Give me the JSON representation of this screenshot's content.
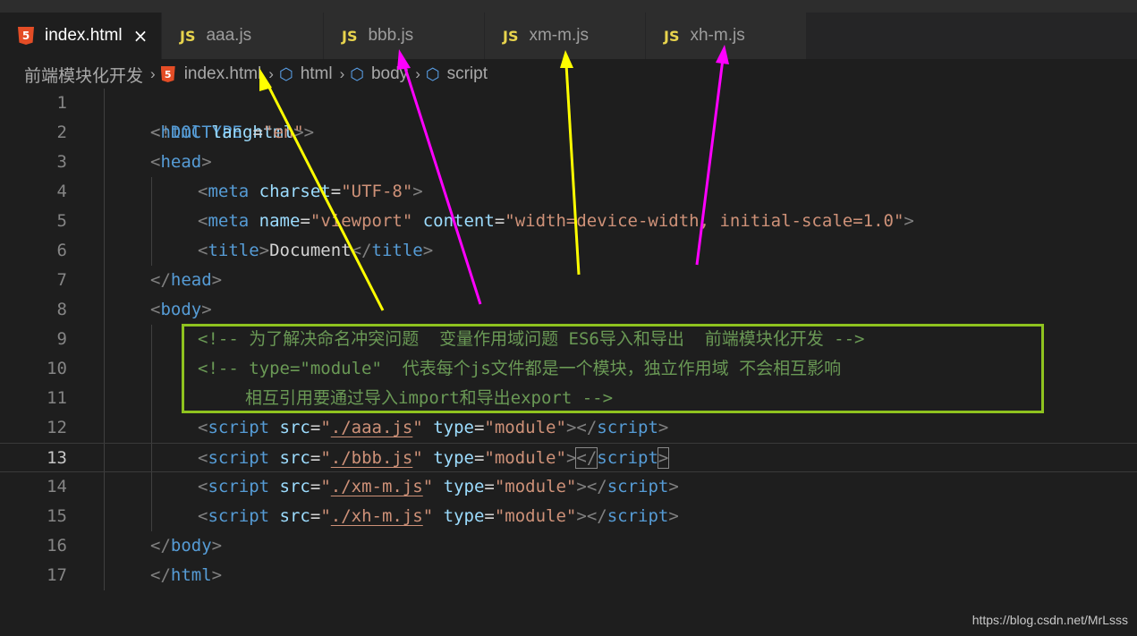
{
  "tabs": [
    {
      "label": "index.html",
      "type": "html",
      "active": true,
      "close": "×"
    },
    {
      "label": "aaa.js",
      "type": "js"
    },
    {
      "label": "bbb.js",
      "type": "js"
    },
    {
      "label": "xm-m.js",
      "type": "js"
    },
    {
      "label": "xh-m.js",
      "type": "js"
    }
  ],
  "tab_icons": {
    "js": "JS",
    "html": "5"
  },
  "breadcrumb": {
    "folder": "前端模块化开发",
    "file": "index.html",
    "items": [
      "html",
      "body",
      "script"
    ],
    "separator": "›"
  },
  "lines": [
    {
      "n": "1"
    },
    {
      "n": "2"
    },
    {
      "n": "3"
    },
    {
      "n": "4"
    },
    {
      "n": "5"
    },
    {
      "n": "6"
    },
    {
      "n": "7"
    },
    {
      "n": "8"
    },
    {
      "n": "9"
    },
    {
      "n": "10"
    },
    {
      "n": "11"
    },
    {
      "n": "12"
    },
    {
      "n": "13"
    },
    {
      "n": "14"
    },
    {
      "n": "15"
    },
    {
      "n": "16"
    },
    {
      "n": "17"
    }
  ],
  "code": {
    "l1": {
      "open": "<!",
      "kw": "DOCTYPE",
      "attr": "html",
      "close": ">"
    },
    "l2": {
      "open": "<",
      "tag": "html",
      "attr": "lang",
      "eq": "=",
      "val": "\"en\"",
      "close": ">"
    },
    "l3": {
      "open": "<",
      "tag": "head",
      "close": ">"
    },
    "l4": {
      "open": "<",
      "tag": "meta",
      "attr": "charset",
      "eq": "=",
      "val": "\"UTF-8\"",
      "close": ">"
    },
    "l5": {
      "open": "<",
      "tag": "meta",
      "attr1": "name",
      "eq1": "=",
      "val1": "\"viewport\"",
      "attr2": "content",
      "eq2": "=",
      "val2": "\"width=device-width, initial-scale=1.0\"",
      "close": ">"
    },
    "l6": {
      "open": "<",
      "tag": "title",
      "close": ">",
      "text": "Document",
      "open2": "</",
      "tag2": "title",
      "close2": ">"
    },
    "l7": {
      "open": "</",
      "tag": "head",
      "close": ">"
    },
    "l8": {
      "open": "<",
      "tag": "body",
      "close": ">"
    },
    "l9": {
      "comment": "<!-- 为了解决命名冲突问题  变量作用域问题 ES6导入和导出  前端模块化开发 -->"
    },
    "l10": {
      "comment": "<!-- type=\"module\"  代表每个js文件都是一个模块，独立作用域 不会相互影响"
    },
    "l11": {
      "comment": "相互引用要通过导入import和导出export -->"
    },
    "script_lines": [
      {
        "src": "./aaa.js"
      },
      {
        "src": "./bbb.js"
      },
      {
        "src": "./xm-m.js"
      },
      {
        "src": "./xh-m.js"
      }
    ],
    "script_tag": "script",
    "src_attr": "src",
    "type_attr": "type",
    "type_val": "\"module\"",
    "quote": "\"",
    "eq": "=",
    "lt": "<",
    "gt": ">",
    "lt_close": "</",
    "l16": {
      "open": "</",
      "tag": "body",
      "close": ">"
    },
    "l17": {
      "open": "</",
      "tag": "html",
      "close": ">"
    }
  },
  "annotation": {
    "box_color": "#8fc31f",
    "arrow_colors": [
      "#ffff00",
      "#ff00ff",
      "#ffff00",
      "#ff00ff"
    ]
  },
  "watermark": "https://blog.csdn.net/MrLsss"
}
